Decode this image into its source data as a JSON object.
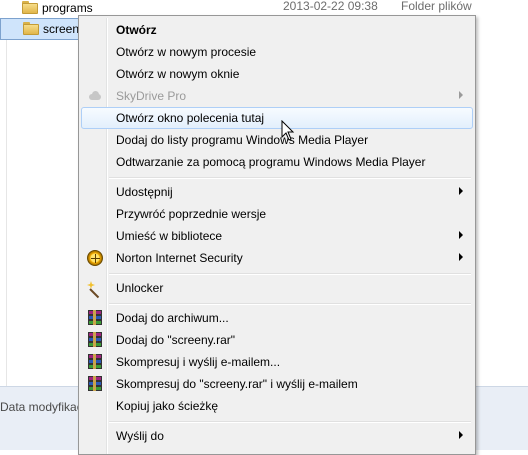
{
  "explorer": {
    "files": [
      {
        "name": "programs",
        "date": "2013-02-22 09:38",
        "type": "Folder plików"
      },
      {
        "name": "screeny",
        "date": "",
        "type": ""
      }
    ],
    "status_left": "Data modyfikac"
  },
  "menu": {
    "items": [
      {
        "label": "Otwórz",
        "bold": true
      },
      {
        "label": "Otwórz w nowym procesie"
      },
      {
        "label": "Otwórz w nowym oknie"
      },
      {
        "label": "SkyDrive Pro",
        "disabled": true,
        "submenu": true,
        "icon": "cloud-icon"
      },
      {
        "label": "Otwórz okno polecenia tutaj",
        "highlight": true
      },
      {
        "label": "Dodaj do listy programu Windows Media Player"
      },
      {
        "label": "Odtwarzanie za pomocą programu Windows Media Player"
      },
      {
        "label": "Udostępnij",
        "submenu": true
      },
      {
        "label": "Przywróć poprzednie wersje"
      },
      {
        "label": "Umieść w bibliotece",
        "submenu": true
      },
      {
        "label": "Norton Internet Security",
        "submenu": true,
        "icon": "norton-icon"
      },
      {
        "label": "Unlocker",
        "icon": "wand-icon"
      },
      {
        "label": "Dodaj do archiwum...",
        "icon": "winrar-icon"
      },
      {
        "label": "Dodaj do \"screeny.rar\"",
        "icon": "winrar-icon"
      },
      {
        "label": "Skompresuj i wyślij e-mailem...",
        "icon": "winrar-icon"
      },
      {
        "label": "Skompresuj do \"screeny.rar\" i wyślij e-mailem",
        "icon": "winrar-icon"
      },
      {
        "label": "Kopiuj jako ścieżkę"
      },
      {
        "label": "Wyślij do",
        "submenu": true
      }
    ]
  },
  "colors": {
    "menu_bg": "#f0f0f0",
    "highlight_bg": "#e3effc",
    "highlight_border": "#aecff7",
    "disabled_text": "#9a9a9a",
    "selection_bg": "#cfe4fb"
  }
}
